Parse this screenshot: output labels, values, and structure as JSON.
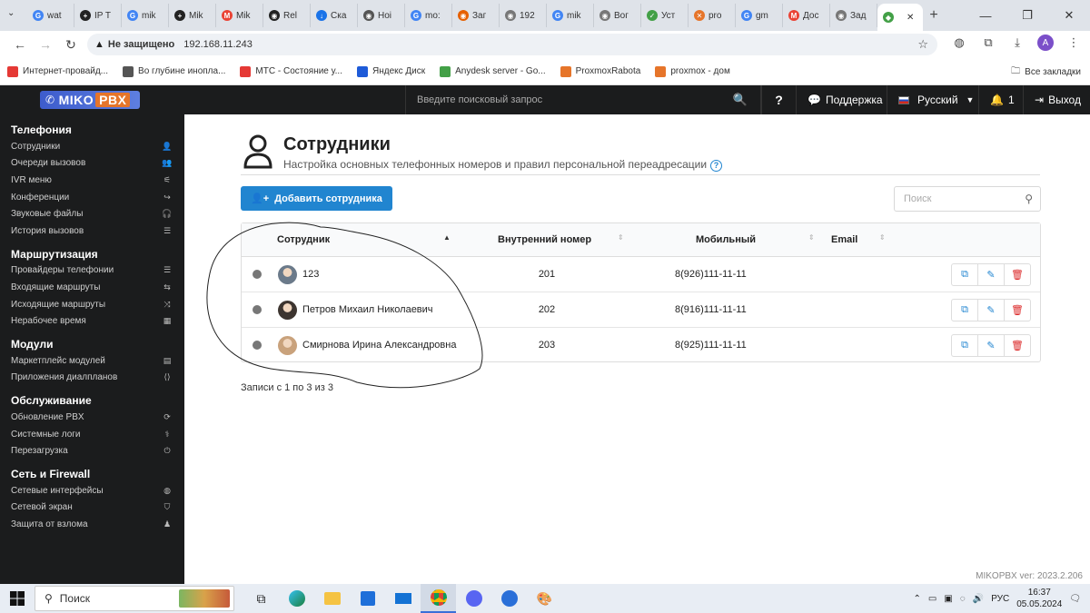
{
  "browser": {
    "tabs": [
      {
        "label": "wat",
        "color": "#4285f4",
        "glyph": "G"
      },
      {
        "label": "IP T",
        "color": "#222",
        "glyph": "+"
      },
      {
        "label": "mik",
        "color": "#4285f4",
        "glyph": "G"
      },
      {
        "label": "Mik",
        "color": "#222",
        "glyph": "+"
      },
      {
        "label": "Mik",
        "color": "#ea4335",
        "glyph": "M"
      },
      {
        "label": "Rel",
        "color": "#222",
        "glyph": "◉"
      },
      {
        "label": "Ска",
        "color": "#1a73e8",
        "glyph": "↓"
      },
      {
        "label": "Ноі",
        "color": "#555",
        "glyph": "◉"
      },
      {
        "label": "mo:",
        "color": "#4285f4",
        "glyph": "G"
      },
      {
        "label": "Заг",
        "color": "#e66000",
        "glyph": "◉"
      },
      {
        "label": "192",
        "color": "#777",
        "glyph": "◉"
      },
      {
        "label": "mik",
        "color": "#4285f4",
        "glyph": "G"
      },
      {
        "label": "Вог",
        "color": "#777",
        "glyph": "◉"
      },
      {
        "label": "Уст",
        "color": "#43a047",
        "glyph": "✓"
      },
      {
        "label": "pro",
        "color": "#e6752a",
        "glyph": "✕"
      },
      {
        "label": "gm",
        "color": "#4285f4",
        "glyph": "G"
      },
      {
        "label": "Дос",
        "color": "#ea4335",
        "glyph": "M"
      },
      {
        "label": "Зад",
        "color": "#777",
        "glyph": "◉"
      },
      {
        "label": "",
        "color": "#43a047",
        "glyph": "◆",
        "active": true
      }
    ],
    "security_label": "Не защищено",
    "url": "192.168.11.243",
    "avatar_letter": "A",
    "bookmarks": [
      {
        "label": "Интернет-провайд...",
        "color": "#e53935"
      },
      {
        "label": "Во глубине инопла...",
        "color": "#555"
      },
      {
        "label": "МТС - Состояние у...",
        "color": "#e53935"
      },
      {
        "label": "Яндекс Диск",
        "color": "#1e5bd8"
      },
      {
        "label": "Anydesk server - Go...",
        "color": "#43a047"
      },
      {
        "label": "ProxmoxRabota",
        "color": "#e6752a"
      },
      {
        "label": "proxmox - дом",
        "color": "#e6752a"
      }
    ],
    "all_bookmarks": "Все закладки"
  },
  "header": {
    "logo_miko": "MIKO",
    "logo_pbx": "PBX",
    "search_placeholder": "Введите поисковый запрос",
    "help": "?",
    "support": "Поддержка",
    "language": "Русский",
    "notifications_count": "1",
    "logout": "Выход"
  },
  "sidebar": [
    {
      "title": "Телефония",
      "items": [
        {
          "label": "Сотрудники",
          "icon": "user-icon",
          "glyph": "👤"
        },
        {
          "label": "Очереди вызовов",
          "icon": "users-icon",
          "glyph": "👥"
        },
        {
          "label": "IVR меню",
          "icon": "sitemap-icon",
          "glyph": "⚟"
        },
        {
          "label": "Конференции",
          "icon": "phone-forward-icon",
          "glyph": "↪"
        },
        {
          "label": "Звуковые файлы",
          "icon": "headphones-icon",
          "glyph": "🎧"
        },
        {
          "label": "История вызовов",
          "icon": "list-icon",
          "glyph": "☰"
        }
      ]
    },
    {
      "title": "Маршрутизация",
      "items": [
        {
          "label": "Провайдеры телефонии",
          "icon": "server-icon",
          "glyph": "☰"
        },
        {
          "label": "Входящие маршруты",
          "icon": "signpost-icon",
          "glyph": "⇆"
        },
        {
          "label": "Исходящие маршруты",
          "icon": "shuffle-icon",
          "glyph": "⤨"
        },
        {
          "label": "Нерабочее время",
          "icon": "calendar-icon",
          "glyph": "▦"
        }
      ]
    },
    {
      "title": "Модули",
      "items": [
        {
          "label": "Маркетплейс модулей",
          "icon": "store-icon",
          "glyph": "▤"
        },
        {
          "label": "Приложения диалпланов",
          "icon": "code-icon",
          "glyph": "⟨⟩"
        }
      ]
    },
    {
      "title": "Обслуживание",
      "items": [
        {
          "label": "Обновление PBX",
          "icon": "sync-icon",
          "glyph": "⟳"
        },
        {
          "label": "Системные логи",
          "icon": "stethoscope-icon",
          "glyph": "⚕"
        },
        {
          "label": "Перезагрузка",
          "icon": "power-icon",
          "glyph": "⏻"
        }
      ]
    },
    {
      "title": "Сеть и Firewall",
      "items": [
        {
          "label": "Сетевые интерфейсы",
          "icon": "globe-icon",
          "glyph": "◍"
        },
        {
          "label": "Сетевой экран",
          "icon": "shield-icon",
          "glyph": "⛉"
        },
        {
          "label": "Защита от взлома",
          "icon": "user-secret-icon",
          "glyph": "♟"
        }
      ]
    }
  ],
  "page": {
    "title": "Сотрудники",
    "subtitle": "Настройка основных телефонных номеров и правил персональной переадресации",
    "help_glyph": "?",
    "add_button": "Добавить сотрудника",
    "search_placeholder": "Поиск",
    "columns": [
      "Сотрудник",
      "Внутренний номер",
      "Мобильный",
      "Email"
    ],
    "rows": [
      {
        "name": "123",
        "extension": "201",
        "mobile": "8(926)111-11-11",
        "email": "",
        "avatar_color": "#6b7a8a"
      },
      {
        "name": "Петров Михаил Николаевич",
        "extension": "202",
        "mobile": "8(916)111-11-11",
        "email": "",
        "avatar_color": "#3d3530"
      },
      {
        "name": "Смирнова Ирина Александровна",
        "extension": "203",
        "mobile": "8(925)111-11-11",
        "email": "",
        "avatar_color": "#c9a27c"
      }
    ],
    "records_info": "Записи с 1 по 3 из 3",
    "version": "MIKOPBX ver: 2023.2.206"
  },
  "taskbar": {
    "search_label": "Поиск",
    "language": "РУС",
    "time": "16:37",
    "date": "05.05.2024"
  }
}
